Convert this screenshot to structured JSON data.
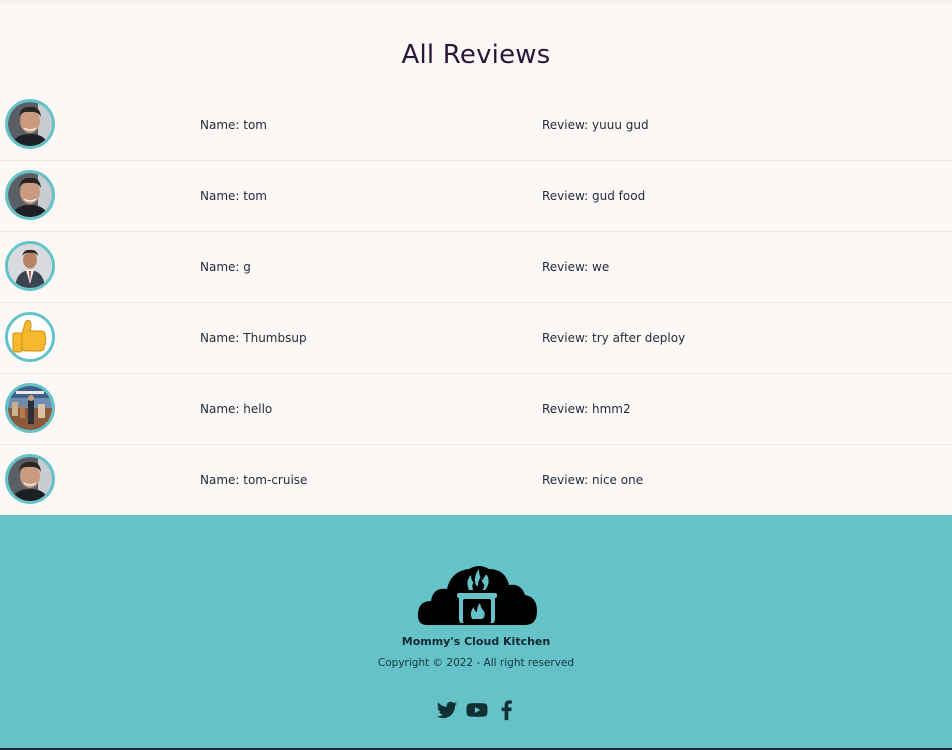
{
  "page": {
    "title": "All Reviews"
  },
  "reviews": [
    {
      "name": "Name: tom",
      "review": "Review: yuuu gud",
      "avatar": "portrait-man-avatar"
    },
    {
      "name": "Name: tom",
      "review": "Review: gud food",
      "avatar": "portrait-man-avatar"
    },
    {
      "name": "Name: g",
      "review": "Review: we",
      "avatar": "suit-man-avatar"
    },
    {
      "name": "Name: Thumbsup",
      "review": "Review: try after deploy",
      "avatar": "thumbs-up-avatar"
    },
    {
      "name": "Name: hello",
      "review": "Review: hmm2",
      "avatar": "city-photo-avatar"
    },
    {
      "name": "Name: tom-cruise",
      "review": "Review: nice one",
      "avatar": "portrait-man-avatar"
    }
  ],
  "footer": {
    "brand": "Mommy's Cloud Kitchen",
    "copyright": "Copyright © 2022 - All right reserved",
    "logo": "cloud-kitchen-logo",
    "socials": [
      "twitter-icon",
      "youtube-icon",
      "facebook-icon"
    ],
    "background_color": "#65c2c8"
  },
  "colors": {
    "page_background": "#fcf8f5",
    "avatar_ring": "#64c3c9",
    "title": "#2a1638"
  }
}
